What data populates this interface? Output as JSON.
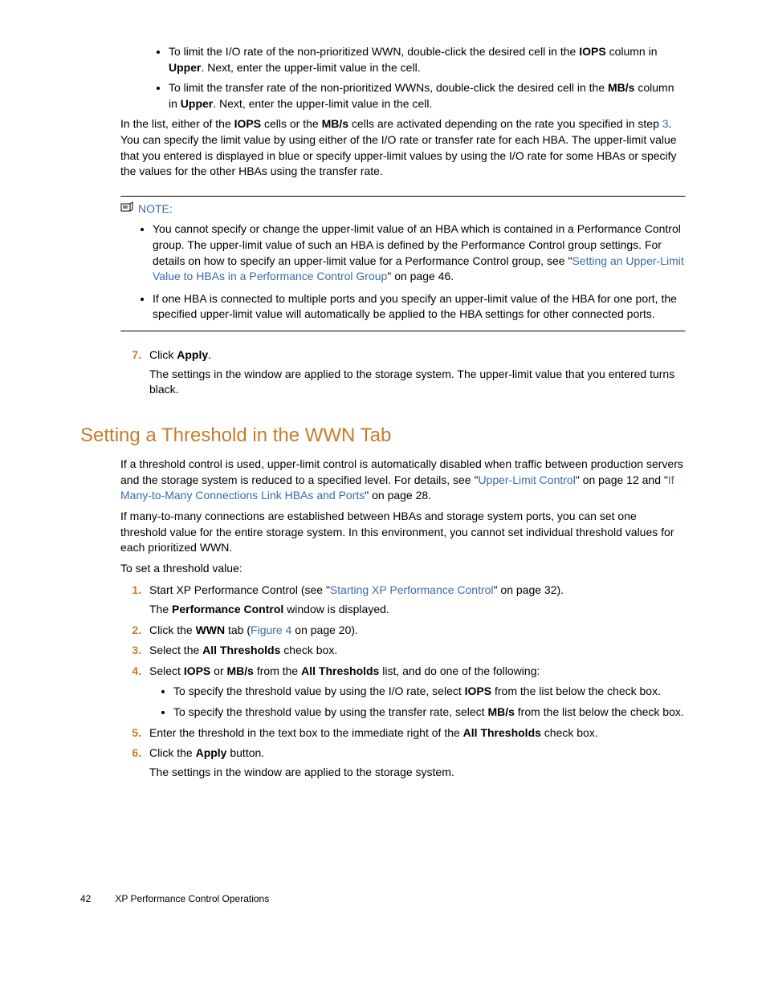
{
  "top": {
    "b1": "To limit the I/O rate of the non-prioritized WWN, double-click the desired cell in the ",
    "b1a": "IOPS",
    "b1b": " column in ",
    "b1c": "Upper",
    "b1d": ". Next, enter the upper-limit value in the cell.",
    "b2": "To limit the transfer rate of the non-prioritized WWNs, double-click the desired cell in the ",
    "b2a": "MB/s",
    "b2b": " column in ",
    "b2c": "Upper",
    "b2d": ". Next, enter the upper-limit value in the cell.",
    "p1a": "In the list, either of the ",
    "p1b": "IOPS",
    "p1c": " cells or the ",
    "p1d": "MB/s",
    "p1e": " cells are activated depending on the rate you specified in step ",
    "p1link": "3",
    "p1f": ". You can specify the limit value by using either of the I/O rate or transfer rate for each HBA. The upper-limit value that you entered is displayed in blue or specify upper-limit values by using the I/O rate for some HBAs or specify the values for the other HBAs using the transfer rate."
  },
  "note": {
    "label": "NOTE:",
    "n1a": "You cannot specify or change the upper-limit value of an HBA which is contained in a Performance Control group. The upper-limit value of such an HBA is defined by the Performance Control group settings. For details on how to specify an upper-limit value for a Performance Control group, see \"",
    "n1link": "Setting an Upper-Limit Value to HBAs in a Performance Control Group",
    "n1b": "\" on page 46.",
    "n2": "If one HBA is connected to multiple ports and you specify an upper-limit value of the HBA for one port, the specified upper-limit value will automatically be applied to the HBA settings for other connected ports."
  },
  "step7": {
    "a": "Click ",
    "b": "Apply",
    "c": ".",
    "d": "The settings in the window are applied to the storage system. The upper-limit value that you entered turns black."
  },
  "heading": "Setting a Threshold in the WWN Tab",
  "intro": {
    "p1a": "If a threshold control is used, upper-limit control is automatically disabled when traffic between production servers and the storage system is reduced to a specified level. For details, see \"",
    "p1link1": "Upper-Limit Control",
    "p1b": "\" on page 12 and \"",
    "p1link2": "If Many-to-Many Connections Link HBAs and Ports",
    "p1c": "\" on page 28.",
    "p2": "If many-to-many connections are established between HBAs and storage system ports, you can set one threshold value for the entire storage system. In this environment, you cannot set individual threshold values for each prioritized WWN.",
    "p3": "To set a threshold value:"
  },
  "steps": {
    "s1a": "Start XP Performance Control (see \"",
    "s1link": "Starting XP Performance Control",
    "s1b": "\" on page 32).",
    "s1c": "The ",
    "s1d": "Performance Control",
    "s1e": " window is displayed.",
    "s2a": "Click the ",
    "s2b": "WWN",
    "s2c": " tab (",
    "s2link": "Figure 4",
    "s2d": " on page 20).",
    "s3a": "Select the ",
    "s3b": "All Thresholds",
    "s3c": " check box.",
    "s4a": "Select ",
    "s4b": "IOPS",
    "s4c": " or ",
    "s4d": "MB/s",
    "s4e": " from the ",
    "s4f": "All Thresholds",
    "s4g": " list, and do one of the following:",
    "s4b1a": "To specify the threshold value by using the I/O rate, select ",
    "s4b1b": "IOPS",
    "s4b1c": " from the list below the check box.",
    "s4b2a": "To specify the threshold value by using the transfer rate, select ",
    "s4b2b": "MB/s",
    "s4b2c": " from the list below the check box.",
    "s5a": "Enter the threshold in the text box to the immediate right of the ",
    "s5b": "All Thresholds",
    "s5c": " check box.",
    "s6a": "Click the ",
    "s6b": "Apply",
    "s6c": " button.",
    "s6d": "The settings in the window are applied to the storage system."
  },
  "footer": {
    "page": "42",
    "title": "XP Performance Control Operations"
  }
}
